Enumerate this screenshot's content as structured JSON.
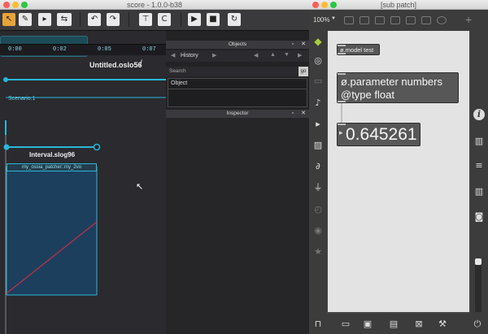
{
  "left_window": {
    "title": "score - 1.0.0-b38"
  },
  "timeline": {
    "ticks": [
      "0:00",
      "0:02",
      "0:05",
      "0:07"
    ]
  },
  "scenario": {
    "state_name": "Untitled.oslo56",
    "scenario_label": "Scenario.1",
    "interval_name": "Interval.slog96",
    "process_label": "my_ossia_patcher::my_2vo"
  },
  "objects_panel": {
    "title": "Objects",
    "history_label": "History",
    "search_label": "Search",
    "go_label": "go",
    "object_label": "Object"
  },
  "inspector_panel": {
    "title": "Inspector"
  },
  "right_window": {
    "title": "[sub patch]",
    "zoom": "100%"
  },
  "max_patch": {
    "model_box": "ø.model test",
    "param_box": "ø.parameter numbers @type float",
    "number_value": "0.645261"
  },
  "colors": {
    "accent": "#29b7d9",
    "interval_fill": "#1c3f5d",
    "curve": "#c0304a",
    "number_box": "#575757"
  }
}
